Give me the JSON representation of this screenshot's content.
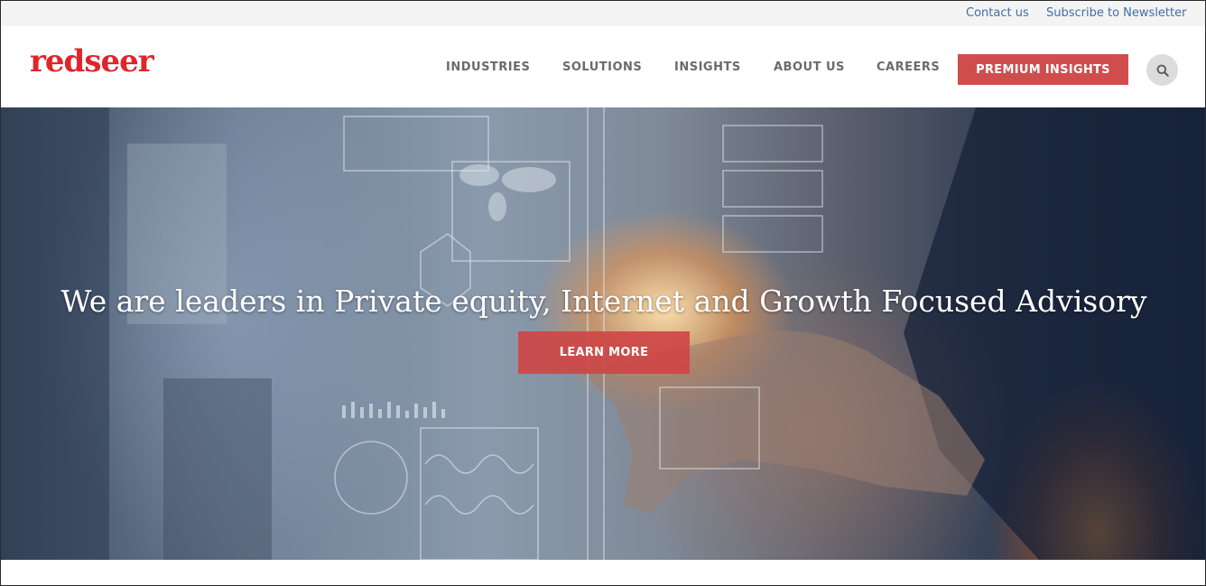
{
  "topbar": {
    "contact_label": "Contact us",
    "subscribe_label": "Subscribe to Newsletter"
  },
  "header": {
    "logo_text": "redseer",
    "nav": {
      "industries": "INDUSTRIES",
      "solutions": "SOLUTIONS",
      "insights": "INSIGHTS",
      "about": "ABOUT US",
      "careers": "CAREERS"
    },
    "premium_label": "PREMIUM INSIGHTS",
    "search_icon": "search-icon"
  },
  "hero": {
    "title": "We are leaders in Private equity, Internet and Growth Focused Advisory",
    "button_label": "LEARN MORE"
  },
  "colors": {
    "brand": "#e1242b",
    "button": "#cf4d4d",
    "link": "#3f6ea6",
    "nav_text": "#6b6b6b"
  }
}
